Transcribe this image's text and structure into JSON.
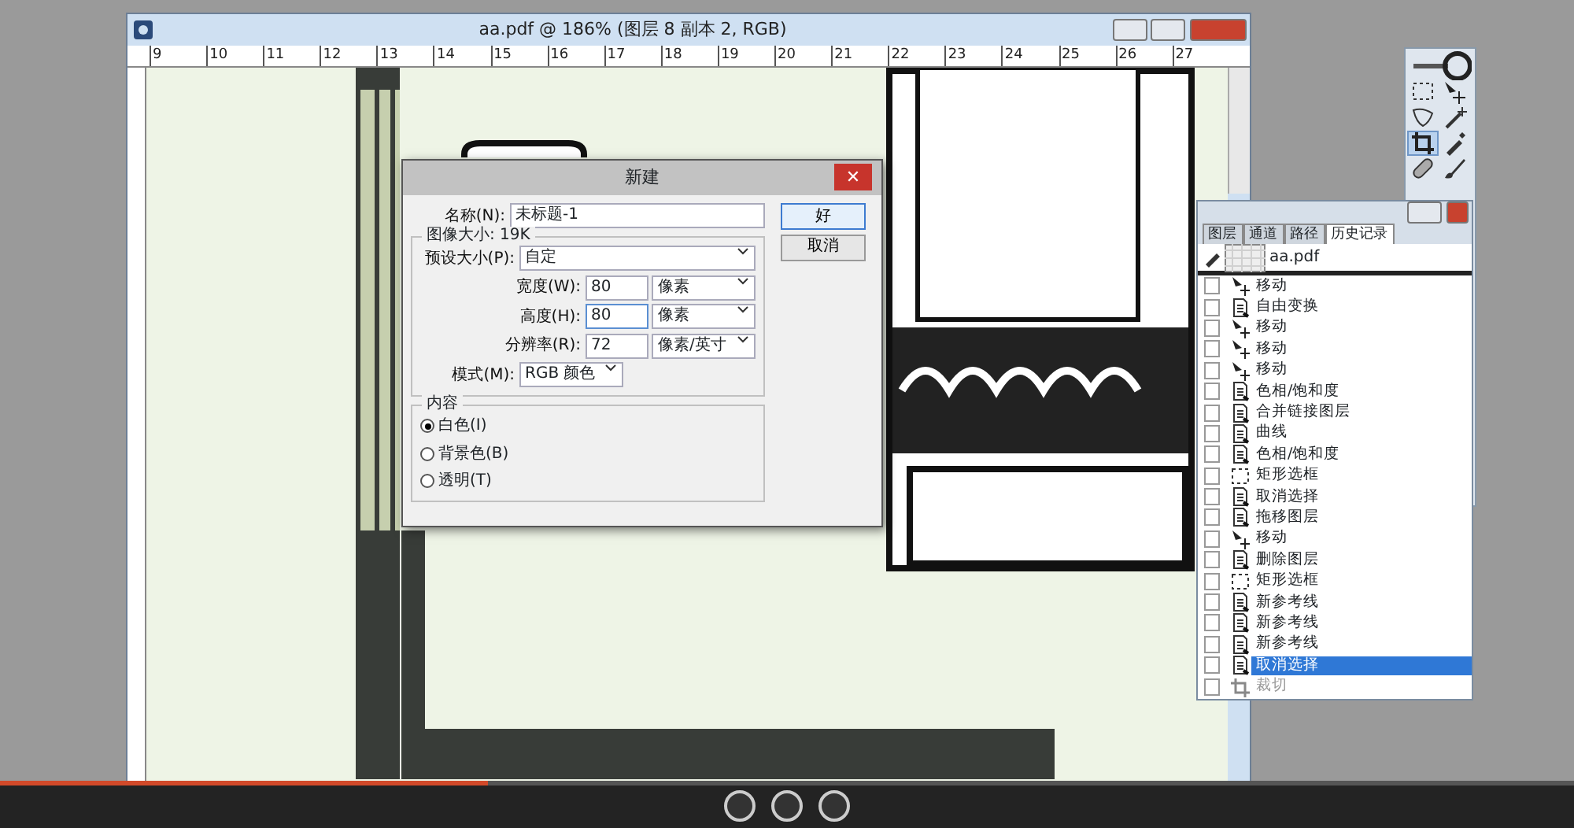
{
  "document": {
    "title": "aa.pdf @ 186% (图层 8 副本 2, RGB)",
    "ruler_labels": [
      "9",
      "10",
      "11",
      "12",
      "13",
      "14",
      "15",
      "16",
      "17",
      "18",
      "19",
      "20",
      "21",
      "22",
      "23",
      "24",
      "25",
      "26",
      "27"
    ]
  },
  "dialog": {
    "title": "新建",
    "name_label": "名称(N):",
    "name_value": "未标题-1",
    "image_size": "图像大小: 19K",
    "preset_label": "预设大小(P):",
    "preset_value": "自定",
    "fields": [
      {
        "label": "宽度(W):",
        "value": "80",
        "unit": "像素",
        "focused": false
      },
      {
        "label": "高度(H):",
        "value": "80",
        "unit": "像素",
        "focused": true
      },
      {
        "label": "分辨率(R):",
        "value": "72",
        "unit": "像素/英寸",
        "focused": false
      }
    ],
    "mode_label": "模式(M):",
    "mode_value": "RGB 颜色",
    "contents_label": "内容",
    "close_glyph": "✕",
    "contents": [
      {
        "label": "白色(I)",
        "selected": true
      },
      {
        "label": "背景色(B)",
        "selected": false
      },
      {
        "label": "透明(T)",
        "selected": false
      }
    ],
    "buttons": [
      {
        "label": "好",
        "default": true
      },
      {
        "label": "取消",
        "default": false
      }
    ]
  },
  "tools": [
    {
      "kind": "marquee",
      "selected": false
    },
    {
      "kind": "move",
      "selected": false
    },
    {
      "kind": "lasso",
      "selected": false
    },
    {
      "kind": "wand",
      "selected": false
    },
    {
      "kind": "crop",
      "selected": true
    },
    {
      "kind": "eyedropper",
      "selected": false
    },
    {
      "kind": "bandage",
      "selected": false
    },
    {
      "kind": "brush",
      "selected": false
    }
  ],
  "history_panel": {
    "tabs": [
      {
        "label": "图层",
        "selected": false
      },
      {
        "label": "通道",
        "selected": false
      },
      {
        "label": "路径",
        "selected": false
      },
      {
        "label": "历史记录",
        "selected": true
      }
    ],
    "snapshot": "aa.pdf",
    "items": [
      {
        "label": "移动",
        "kind": "move",
        "checked": false,
        "selected": false,
        "disabled": false
      },
      {
        "label": "自由变换",
        "kind": "doc",
        "checked": false,
        "selected": false,
        "disabled": false
      },
      {
        "label": "移动",
        "kind": "move",
        "checked": false,
        "selected": false,
        "disabled": false
      },
      {
        "label": "移动",
        "kind": "move",
        "checked": false,
        "selected": false,
        "disabled": false
      },
      {
        "label": "移动",
        "kind": "move",
        "checked": false,
        "selected": false,
        "disabled": false
      },
      {
        "label": "色相/饱和度",
        "kind": "doc",
        "checked": false,
        "selected": false,
        "disabled": false
      },
      {
        "label": "合并链接图层",
        "kind": "doc",
        "checked": false,
        "selected": false,
        "disabled": false
      },
      {
        "label": "曲线",
        "kind": "doc",
        "checked": false,
        "selected": false,
        "disabled": false
      },
      {
        "label": "色相/饱和度",
        "kind": "doc",
        "checked": false,
        "selected": false,
        "disabled": false
      },
      {
        "label": "矩形选框",
        "kind": "marquee",
        "checked": false,
        "selected": false,
        "disabled": false
      },
      {
        "label": "取消选择",
        "kind": "doc",
        "checked": false,
        "selected": false,
        "disabled": false
      },
      {
        "label": "拖移图层",
        "kind": "doc",
        "checked": false,
        "selected": false,
        "disabled": false
      },
      {
        "label": "移动",
        "kind": "move",
        "checked": false,
        "selected": false,
        "disabled": false
      },
      {
        "label": "删除图层",
        "kind": "doc",
        "checked": false,
        "selected": false,
        "disabled": false
      },
      {
        "label": "矩形选框",
        "kind": "marquee",
        "checked": false,
        "selected": false,
        "disabled": false
      },
      {
        "label": "新参考线",
        "kind": "doc",
        "checked": false,
        "selected": false,
        "disabled": false
      },
      {
        "label": "新参考线",
        "kind": "doc",
        "checked": false,
        "selected": false,
        "disabled": false
      },
      {
        "label": "新参考线",
        "kind": "doc",
        "checked": false,
        "selected": false,
        "disabled": false
      },
      {
        "label": "取消选择",
        "kind": "doc",
        "checked": false,
        "selected": true,
        "disabled": false
      },
      {
        "label": "裁切",
        "kind": "crop",
        "checked": false,
        "selected": false,
        "disabled": true
      }
    ]
  },
  "video_player": {
    "progress": {
      "level": 0.31
    }
  }
}
